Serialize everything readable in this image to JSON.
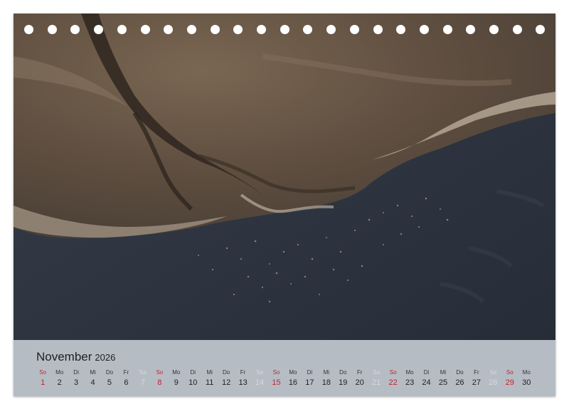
{
  "calendar": {
    "month": "November",
    "year": "2026",
    "days": [
      {
        "name": "So",
        "num": "1",
        "type": "sun"
      },
      {
        "name": "Mo",
        "num": "2",
        "type": "week"
      },
      {
        "name": "Di",
        "num": "3",
        "type": "week"
      },
      {
        "name": "Mi",
        "num": "4",
        "type": "week"
      },
      {
        "name": "Do",
        "num": "5",
        "type": "week"
      },
      {
        "name": "Fr",
        "num": "6",
        "type": "week"
      },
      {
        "name": "Sa",
        "num": "7",
        "type": "sat"
      },
      {
        "name": "So",
        "num": "8",
        "type": "sun"
      },
      {
        "name": "Mo",
        "num": "9",
        "type": "week"
      },
      {
        "name": "Di",
        "num": "10",
        "type": "week"
      },
      {
        "name": "Mi",
        "num": "11",
        "type": "week"
      },
      {
        "name": "Do",
        "num": "12",
        "type": "week"
      },
      {
        "name": "Fr",
        "num": "13",
        "type": "week"
      },
      {
        "name": "Sa",
        "num": "14",
        "type": "sat"
      },
      {
        "name": "So",
        "num": "15",
        "type": "sun"
      },
      {
        "name": "Mo",
        "num": "16",
        "type": "week"
      },
      {
        "name": "Di",
        "num": "17",
        "type": "week"
      },
      {
        "name": "Mi",
        "num": "18",
        "type": "week"
      },
      {
        "name": "Do",
        "num": "19",
        "type": "week"
      },
      {
        "name": "Fr",
        "num": "20",
        "type": "week"
      },
      {
        "name": "Sa",
        "num": "21",
        "type": "sat"
      },
      {
        "name": "So",
        "num": "22",
        "type": "sun"
      },
      {
        "name": "Mo",
        "num": "23",
        "type": "week"
      },
      {
        "name": "Di",
        "num": "24",
        "type": "week"
      },
      {
        "name": "Mi",
        "num": "25",
        "type": "week"
      },
      {
        "name": "Do",
        "num": "26",
        "type": "week"
      },
      {
        "name": "Fr",
        "num": "27",
        "type": "week"
      },
      {
        "name": "Sa",
        "num": "28",
        "type": "sat"
      },
      {
        "name": "So",
        "num": "29",
        "type": "sun"
      },
      {
        "name": "Mo",
        "num": "30",
        "type": "week"
      }
    ]
  },
  "binding": {
    "hole_count": 23
  },
  "colors": {
    "sunday": "#c4232f",
    "saturday": "#d6d9dd",
    "strip": "#b6bcc4",
    "water": "#2c3441",
    "land": "#6e5a48"
  }
}
